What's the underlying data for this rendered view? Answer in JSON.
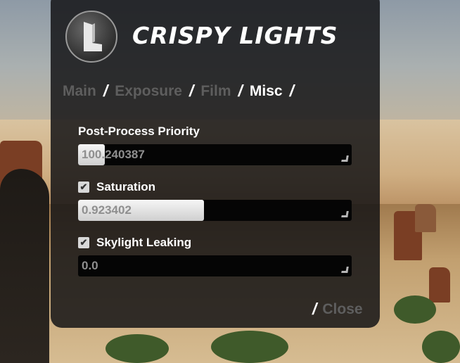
{
  "app": {
    "title": "CRISPY LIGHTS"
  },
  "nav": {
    "separator": "/",
    "tabs": [
      {
        "label": "Main",
        "active": false
      },
      {
        "label": "Exposure",
        "active": false
      },
      {
        "label": "Film",
        "active": false
      },
      {
        "label": "Misc",
        "active": true
      }
    ]
  },
  "settings": {
    "post_process_priority": {
      "label": "Post-Process Priority",
      "value": "100.240387",
      "fill_fraction": 0.1
    },
    "saturation": {
      "label": "Saturation",
      "checked": true,
      "value": "0.923402",
      "fill_fraction": 0.46
    },
    "skylight_leaking": {
      "label": "Skylight Leaking",
      "checked": true,
      "value": "0.0",
      "fill_fraction": 0.0
    }
  },
  "footer": {
    "separator": "/",
    "close_label": "Close"
  },
  "icons": {
    "logo": "crispy-lights-logo",
    "checkbox": "check-icon",
    "grip": "resize-grip-icon"
  },
  "colors": {
    "active_tab": "#ffffff",
    "inactive_tab": "#5e5e5e",
    "panel": "#121214"
  }
}
